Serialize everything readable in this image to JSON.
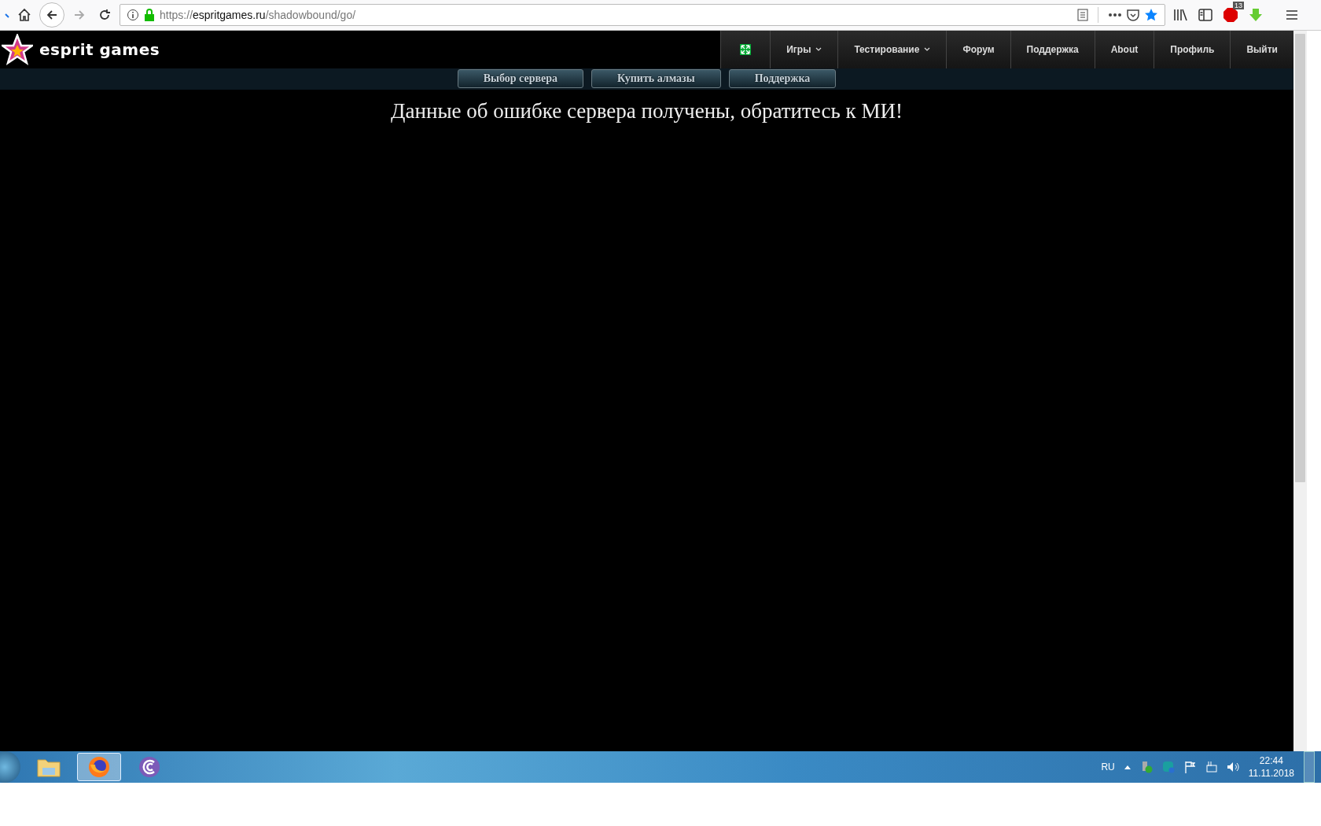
{
  "browser": {
    "url_scheme": "https://",
    "url_host": "espritgames.ru",
    "url_path": "/shadowbound/go/",
    "addon_badge": "13"
  },
  "site": {
    "logo": "esprit games",
    "nav": [
      {
        "kind": "icon"
      },
      {
        "kind": "dropdown",
        "label": "Игры"
      },
      {
        "kind": "dropdown",
        "label": "Тестирование"
      },
      {
        "kind": "link",
        "label": "Форум"
      },
      {
        "kind": "link",
        "label": "Поддержка"
      },
      {
        "kind": "link",
        "label": "About"
      },
      {
        "kind": "link",
        "label": "Профиль"
      },
      {
        "kind": "link",
        "label": "Выйти"
      }
    ],
    "subnav": [
      "Выбор сервера",
      "Купить алмазы",
      "Поддержка"
    ],
    "message": "Данные об ошибке сервера получены, обратитесь к МИ!"
  },
  "taskbar": {
    "apps": [
      {
        "kind": "explorer",
        "selected": false
      },
      {
        "kind": "firefox",
        "selected": true
      },
      {
        "kind": "torrent",
        "selected": false
      }
    ],
    "language": "RU",
    "time": "22:44",
    "date": "11.11.2018"
  }
}
